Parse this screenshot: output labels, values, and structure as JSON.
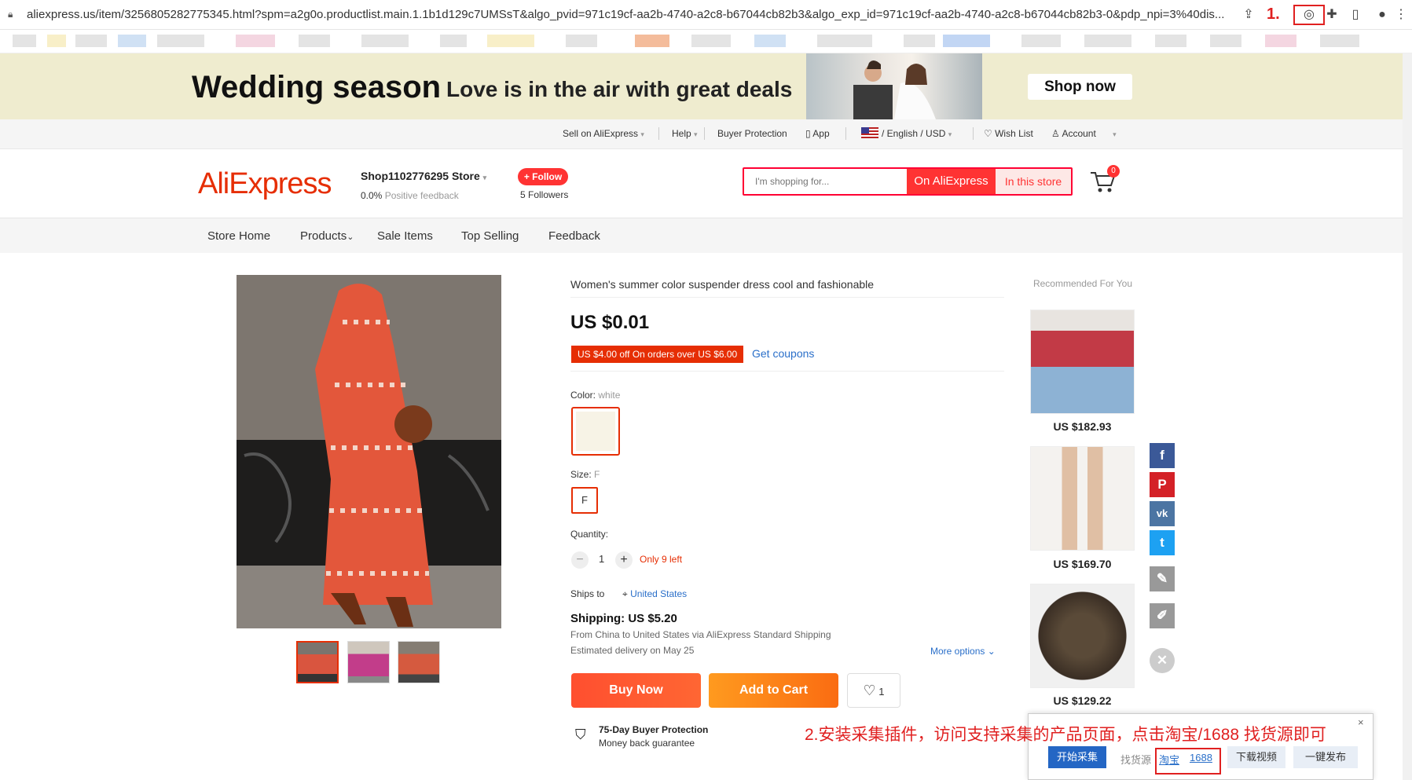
{
  "browser": {
    "url": "aliexpress.us/item/3256805282775345.html?spm=a2g0o.productlist.main.1.1b1d129c7UMSsT&algo_pvid=971c19cf-aa2b-4740-a2c8-b67044cb82b3&algo_exp_id=971c19cf-aa2b-4740-a2c8-b67044cb82b3-0&pdp_npi=3%40dis...",
    "annotation_1": "1."
  },
  "banner": {
    "title": "Wedding season",
    "subtitle": "Love is in the air with great deals",
    "button": "Shop now"
  },
  "topnav": {
    "sell": "Sell on AliExpress",
    "help": "Help",
    "buyer_protection": "Buyer Protection",
    "app": "App",
    "language": "/ English /  USD",
    "wishlist": "Wish List",
    "account": "Account"
  },
  "header": {
    "logo": "AliExpress",
    "store_name": "Shop1102776295 Store",
    "feedback_value": "0.0%",
    "feedback_label": "Positive feedback",
    "follow": "+ Follow",
    "followers": "5 Followers",
    "search_placeholder": "I'm shopping for...",
    "search_ali": "On AliExpress",
    "search_store": "In this store",
    "cart_count": "0"
  },
  "storenav": {
    "items": [
      "Store Home",
      "Products",
      "Sale Items",
      "Top Selling",
      "Feedback"
    ]
  },
  "product": {
    "title": "Women's summer color suspender dress cool and fashionable",
    "price": "US $0.01",
    "coupon": "US $4.00 off On orders over US $6.00",
    "get_coupons": "Get coupons",
    "color_label": "Color:",
    "color_value": "white",
    "size_label": "Size:",
    "size_value": "F",
    "size_option": "F",
    "quantity_label": "Quantity:",
    "quantity": "1",
    "minus": "−",
    "plus": "+",
    "only_left": "Only 9 left",
    "ships_label": "Ships to",
    "ships_to": "United States",
    "shipping": "Shipping: US $5.20",
    "from": "From China to United States via AliExpress Standard Shipping",
    "delivery": "Estimated delivery on May 25",
    "more_options": "More options",
    "buy_now": "Buy Now",
    "add_to_cart": "Add to Cart",
    "wish_count": "1",
    "protection_title": "75-Day Buyer Protection",
    "protection_sub": "Money back guarantee"
  },
  "recommended": {
    "title": "Recommended For You",
    "items": [
      {
        "price": "US $182.93"
      },
      {
        "price": "US $169.70"
      },
      {
        "price": "US $129.22"
      }
    ]
  },
  "social": [
    "f",
    "P",
    "vk",
    "t"
  ],
  "plugin": {
    "annotation_2": "2.安装采集插件，访问支持采集的产品页面，点击淘宝/1688 找货源即可",
    "start": "开始采集",
    "find_source": "找货源",
    "taobao": "淘宝",
    "s1688": "1688",
    "download_video": "下载视频",
    "publish": "一键发布",
    "close": "×"
  },
  "colors": {
    "accent": "#e62e04",
    "link": "#2a6fc9",
    "banner_bg": "#efeccf",
    "annotation": "#e02020"
  }
}
